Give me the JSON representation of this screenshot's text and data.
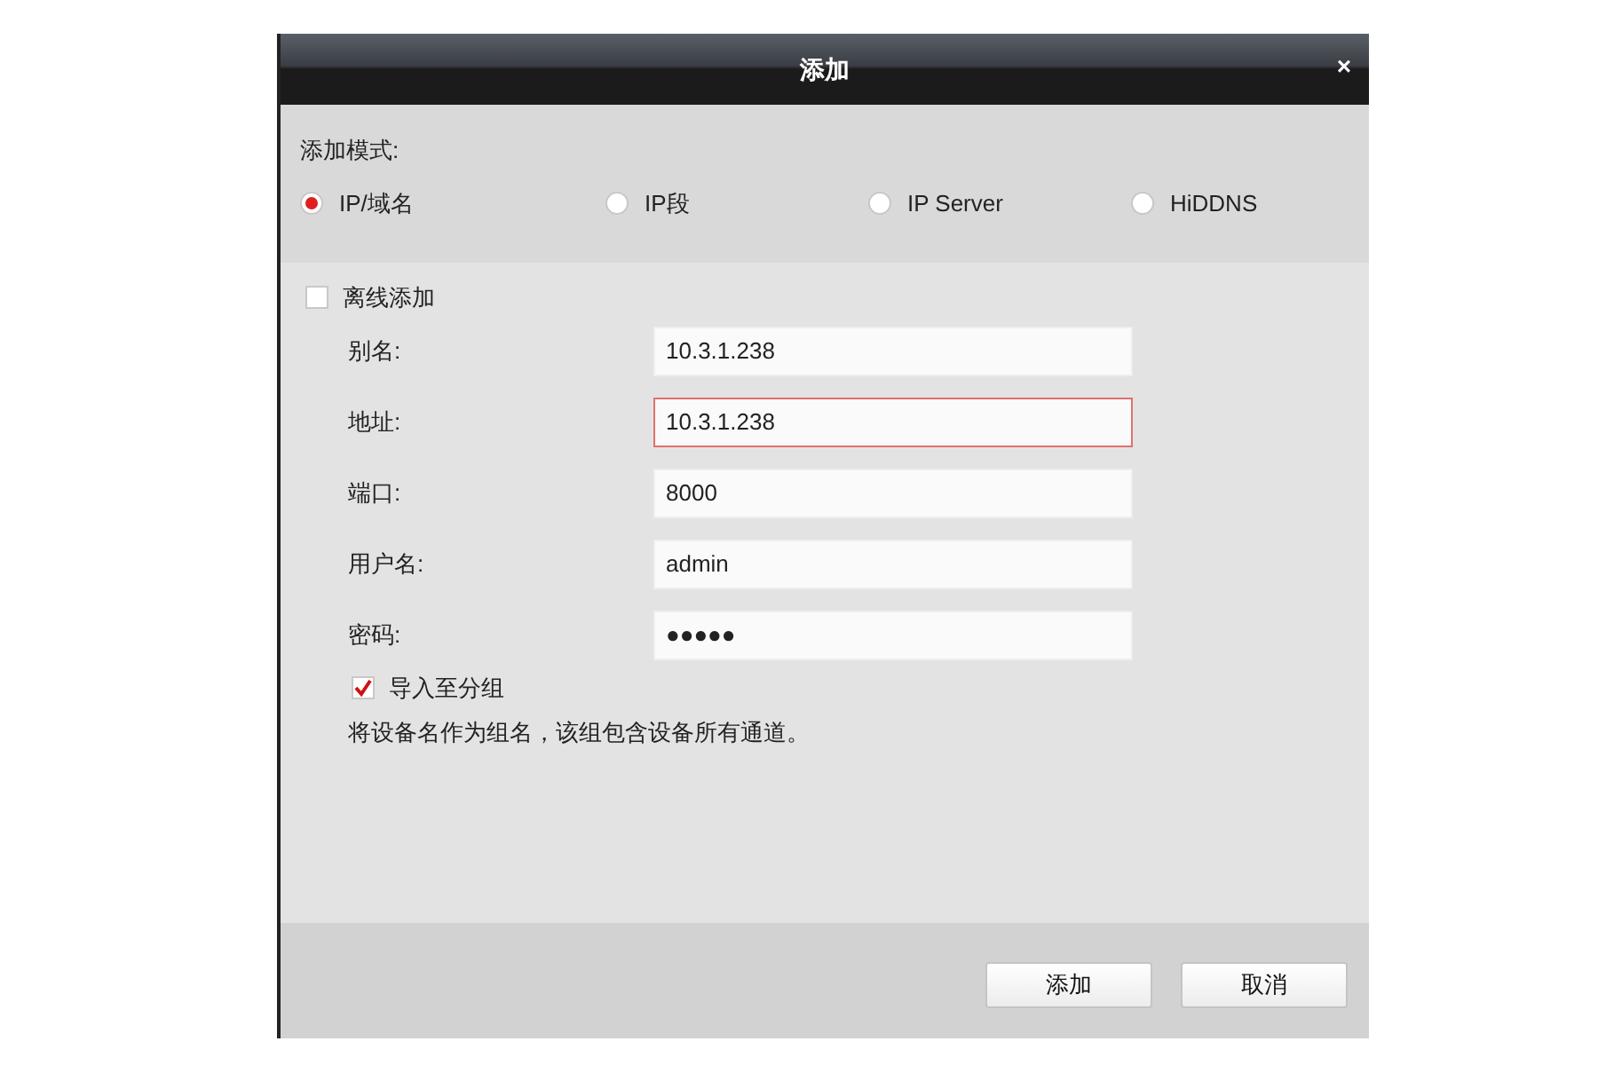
{
  "window": {
    "title": "添加",
    "close": "×"
  },
  "mode": {
    "label": "添加模式:",
    "options": [
      {
        "label": "IP/域名",
        "selected": true
      },
      {
        "label": "IP段",
        "selected": false
      },
      {
        "label": "IP Server",
        "selected": false
      },
      {
        "label": "HiDDNS",
        "selected": false
      }
    ]
  },
  "offline_add": {
    "label": "离线添加",
    "checked": false
  },
  "fields": [
    {
      "label": "别名:",
      "value": "10.3.1.238",
      "error": false
    },
    {
      "label": "地址:",
      "value": "10.3.1.238",
      "error": true
    },
    {
      "label": "端口:",
      "value": "8000",
      "error": false
    },
    {
      "label": "用户名:",
      "value": "admin",
      "error": false
    },
    {
      "label": "密码:",
      "value": "●●●●●",
      "error": false
    }
  ],
  "import_group": {
    "label": "导入至分组",
    "checked": true
  },
  "note": "将设备名作为组名，该组包含设备所有通道。",
  "buttons": [
    "添加",
    "取消"
  ]
}
